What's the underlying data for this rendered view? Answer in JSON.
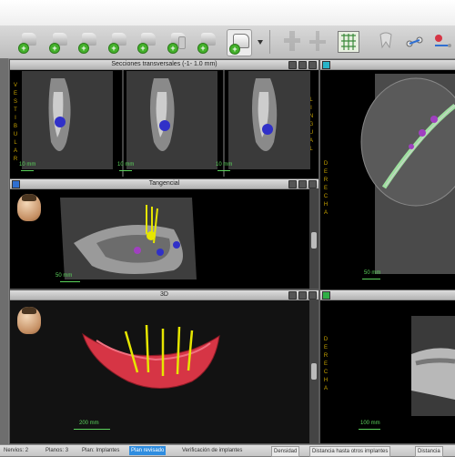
{
  "toolbar": {
    "buttons": [
      {
        "id": "add-implant-1"
      },
      {
        "id": "add-implant-2"
      },
      {
        "id": "add-implant-3"
      },
      {
        "id": "add-implant-4"
      },
      {
        "id": "add-implant-5"
      },
      {
        "id": "add-implant-6"
      },
      {
        "id": "add-implant-7"
      },
      {
        "id": "add-implant-8"
      }
    ],
    "plus_glyph": "+"
  },
  "viewports": {
    "sections": {
      "title": "Secciones transversales (-1- 1.0 mm)",
      "label_left": "VESTIBULAR",
      "label_right": "LINGUAL",
      "scale_labels": [
        "10 mm",
        "10 mm",
        "10 mm"
      ]
    },
    "axial": {
      "label_right": "DERECHA",
      "scale_label": "50 mm"
    },
    "tangential": {
      "title": "Tangencial",
      "scale_label": "50 mm"
    },
    "view3d": {
      "title": "3D",
      "scale_label": "200 mm"
    },
    "sagittal": {
      "label_left": "DERECHA",
      "scale_label": "100 mm"
    }
  },
  "status": {
    "items": [
      {
        "label": "Nervios:",
        "value": "2"
      },
      {
        "label": "Planos:",
        "value": "3"
      },
      {
        "label": "Plan:",
        "value": "Implantes"
      },
      {
        "label": "Plan revisado"
      },
      {
        "label": "Verificación de implantes"
      },
      {
        "label": "Densidad"
      },
      {
        "label": "Distancia hasta otros implantes"
      },
      {
        "label": "Distancia"
      }
    ]
  },
  "colors": {
    "accent_blue": "#2f8de0",
    "implant_yellow": "#e6e600",
    "mandible_red": "#d63545",
    "scale_green": "#5bd35b"
  }
}
